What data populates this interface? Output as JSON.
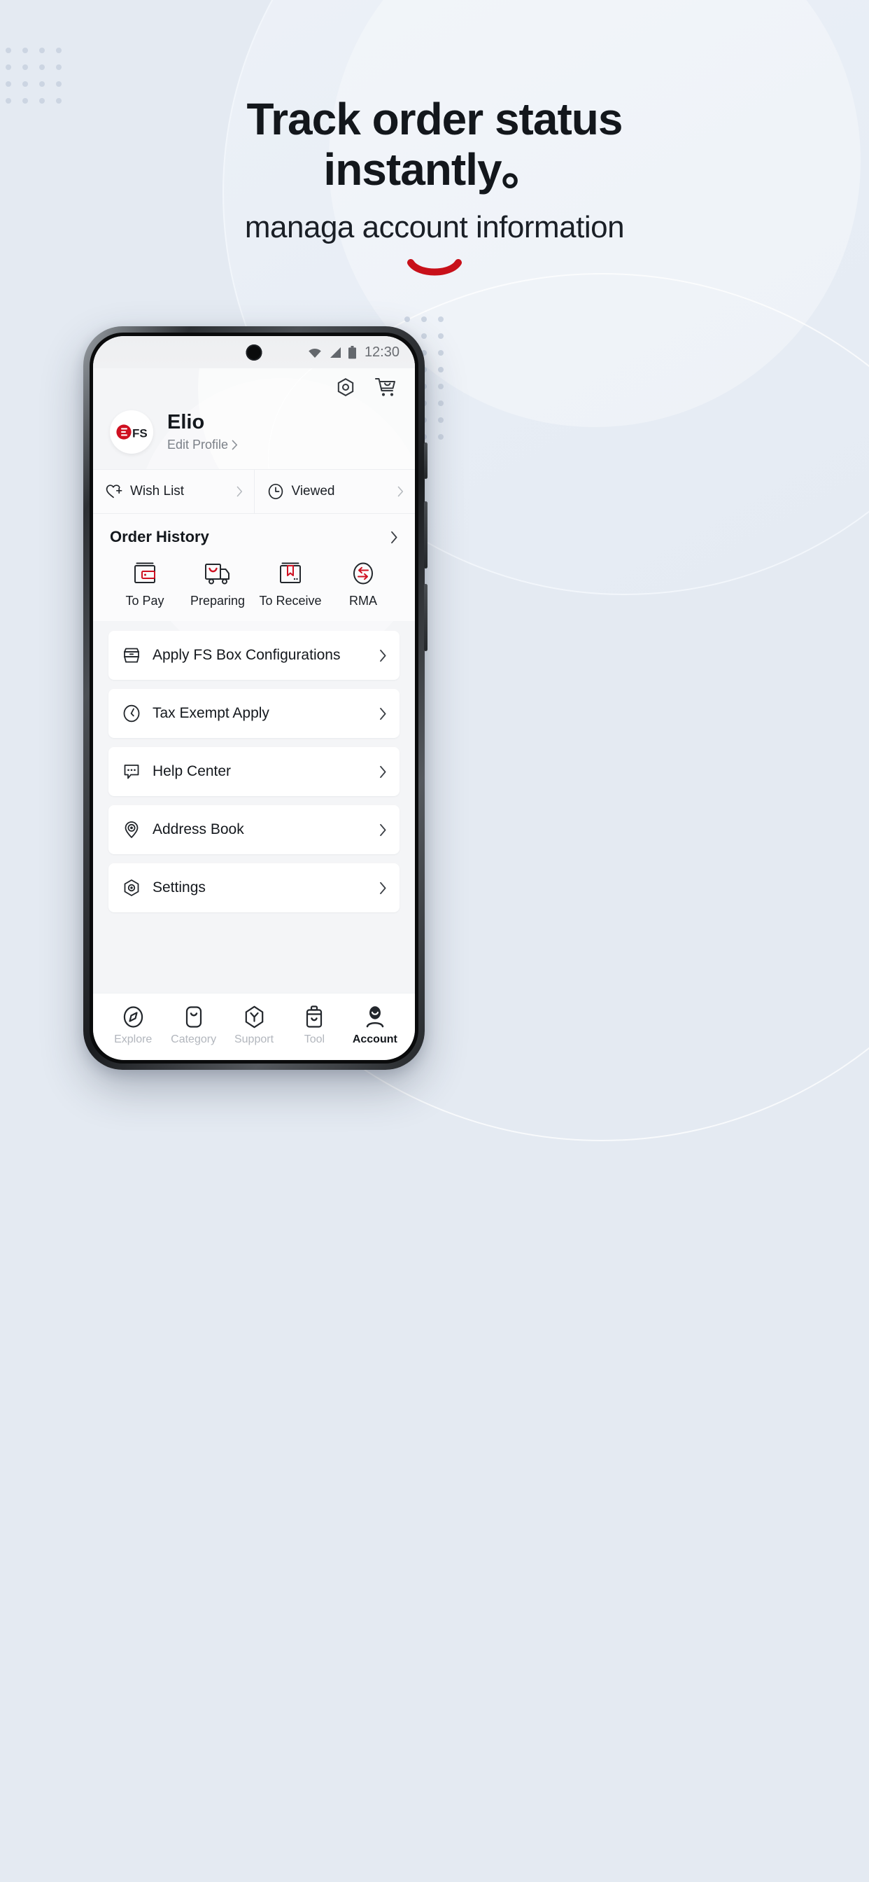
{
  "hero": {
    "title_line_1": "Track order status",
    "title_line_2": "instantly。",
    "subtitle": "managa account information",
    "accent_color": "#c8101a",
    "background_color": "#e4eaf2"
  },
  "phone": {
    "statusbar": {
      "time": "12:30",
      "wifi_icon": "wifi-icon",
      "signal_icon": "cellular-signal-icon",
      "battery_icon": "battery-icon"
    },
    "app_actions": [
      {
        "name": "settings-icon",
        "label": "Settings"
      },
      {
        "name": "cart-icon",
        "label": "Cart"
      }
    ],
    "profile": {
      "avatar_logo_text": "FS",
      "name": "Elio",
      "edit_label": "Edit Profile",
      "edit_chevron": "chevron-right-icon"
    },
    "quick_links": [
      {
        "label": "Wish List",
        "icon": "heart-plus-icon"
      },
      {
        "label": "Viewed",
        "icon": "clock-icon"
      }
    ],
    "order_history": {
      "title": "Order History",
      "chevron": "chevron-right-icon",
      "items": [
        {
          "label": "To Pay",
          "icon": "wallet-icon"
        },
        {
          "label": "Preparing",
          "icon": "truck-icon"
        },
        {
          "label": "To Receive",
          "icon": "box-bookmark-icon"
        },
        {
          "label": "RMA",
          "icon": "return-arrows-icon"
        }
      ]
    },
    "menu": [
      {
        "label": "Apply FS Box Configurations",
        "icon": "box-config-icon"
      },
      {
        "label": "Tax Exempt Apply",
        "icon": "clock-tax-icon"
      },
      {
        "label": "Help Center",
        "icon": "chat-bubble-icon"
      },
      {
        "label": "Address Book",
        "icon": "map-pin-icon"
      },
      {
        "label": "Settings",
        "icon": "hexagon-gear-icon"
      }
    ],
    "tabbar": [
      {
        "label": "Explore",
        "icon": "compass-icon",
        "active": false
      },
      {
        "label": "Category",
        "icon": "category-icon",
        "active": false
      },
      {
        "label": "Support",
        "icon": "support-icon",
        "active": false
      },
      {
        "label": "Tool",
        "icon": "tool-bag-icon",
        "active": false
      },
      {
        "label": "Account",
        "icon": "account-icon",
        "active": true
      }
    ]
  }
}
